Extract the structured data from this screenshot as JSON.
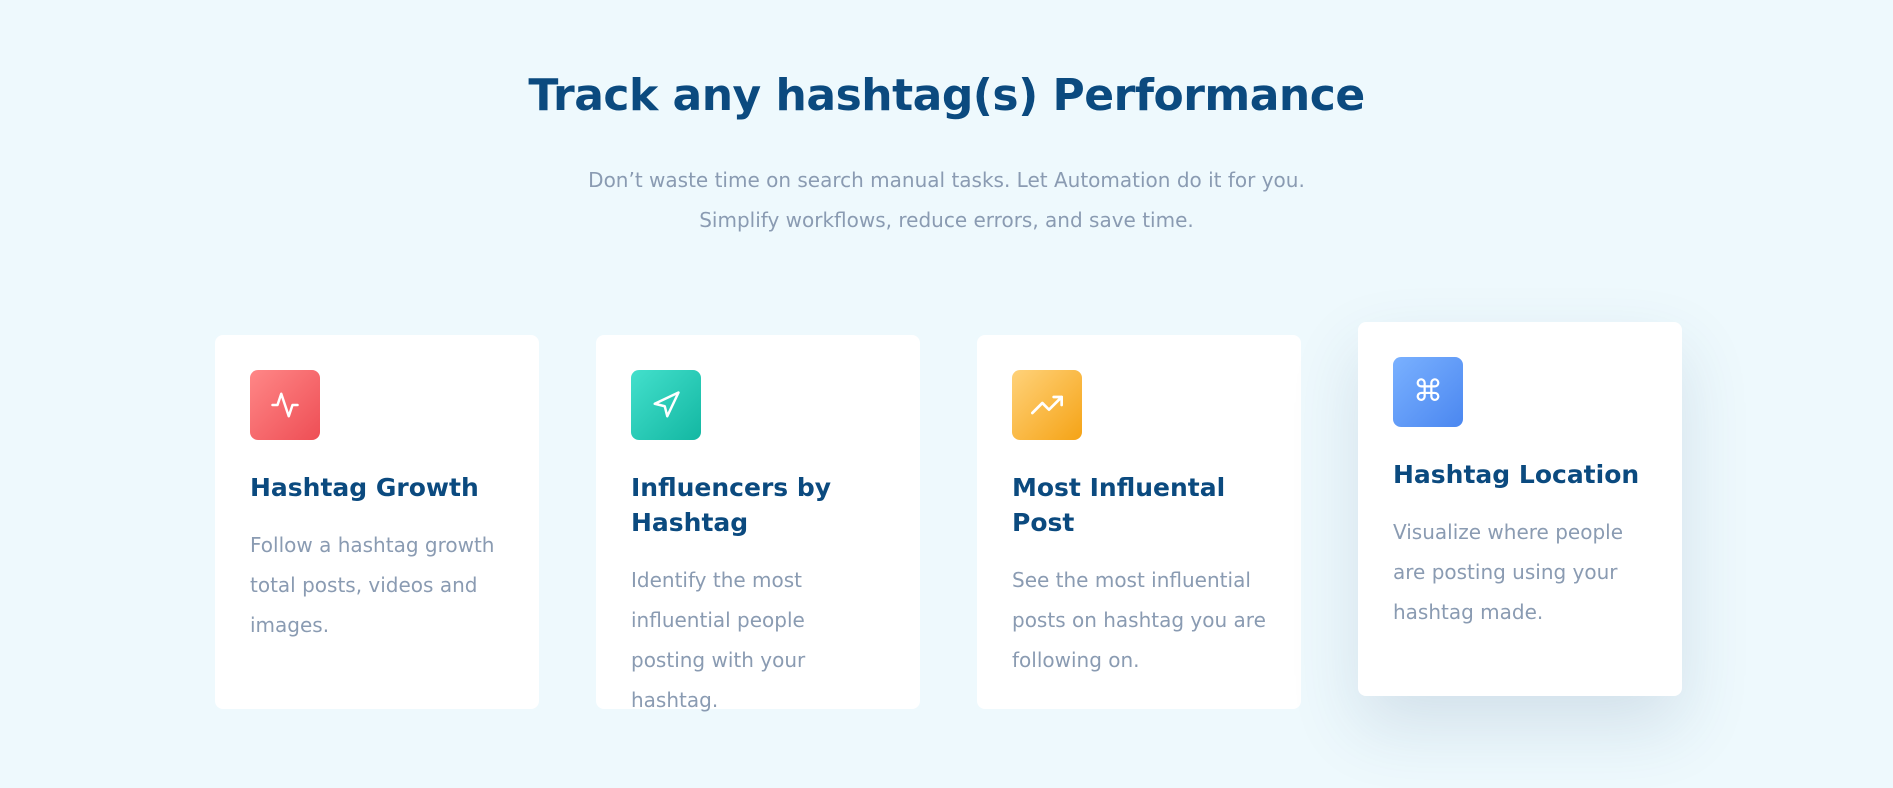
{
  "section": {
    "title": "Track any hashtag(s) Performance",
    "subtitle_line1": "Don’t waste time on search manual tasks. Let Automation do it for you.",
    "subtitle_line2": "Simplify workflows, reduce errors, and save time."
  },
  "cards": [
    {
      "icon": "activity-pulse-icon",
      "icon_color": "#ef5a5f",
      "title": "Hashtag Growth",
      "text": "Follow a hashtag growth total posts, videos and images."
    },
    {
      "icon": "send-navigation-icon",
      "icon_color": "#1fc3ad",
      "title": "Influencers by Hashtag",
      "text": "Identify the most influential people posting with your hashtag."
    },
    {
      "icon": "trending-up-icon",
      "icon_color": "#f7ad2c",
      "title": "Most Influental Post",
      "text": "See the most influential posts on hashtag you are following on."
    },
    {
      "icon": "command-icon",
      "icon_color": "#5b93f5",
      "glyph": "⌘",
      "title": "Hashtag Location",
      "text": "Visualize where people are posting using your hashtag made."
    }
  ],
  "colors": {
    "background": "#eef9fd",
    "heading": "#0b4a7f",
    "body_text": "#8a9bb2",
    "card": "#ffffff"
  }
}
